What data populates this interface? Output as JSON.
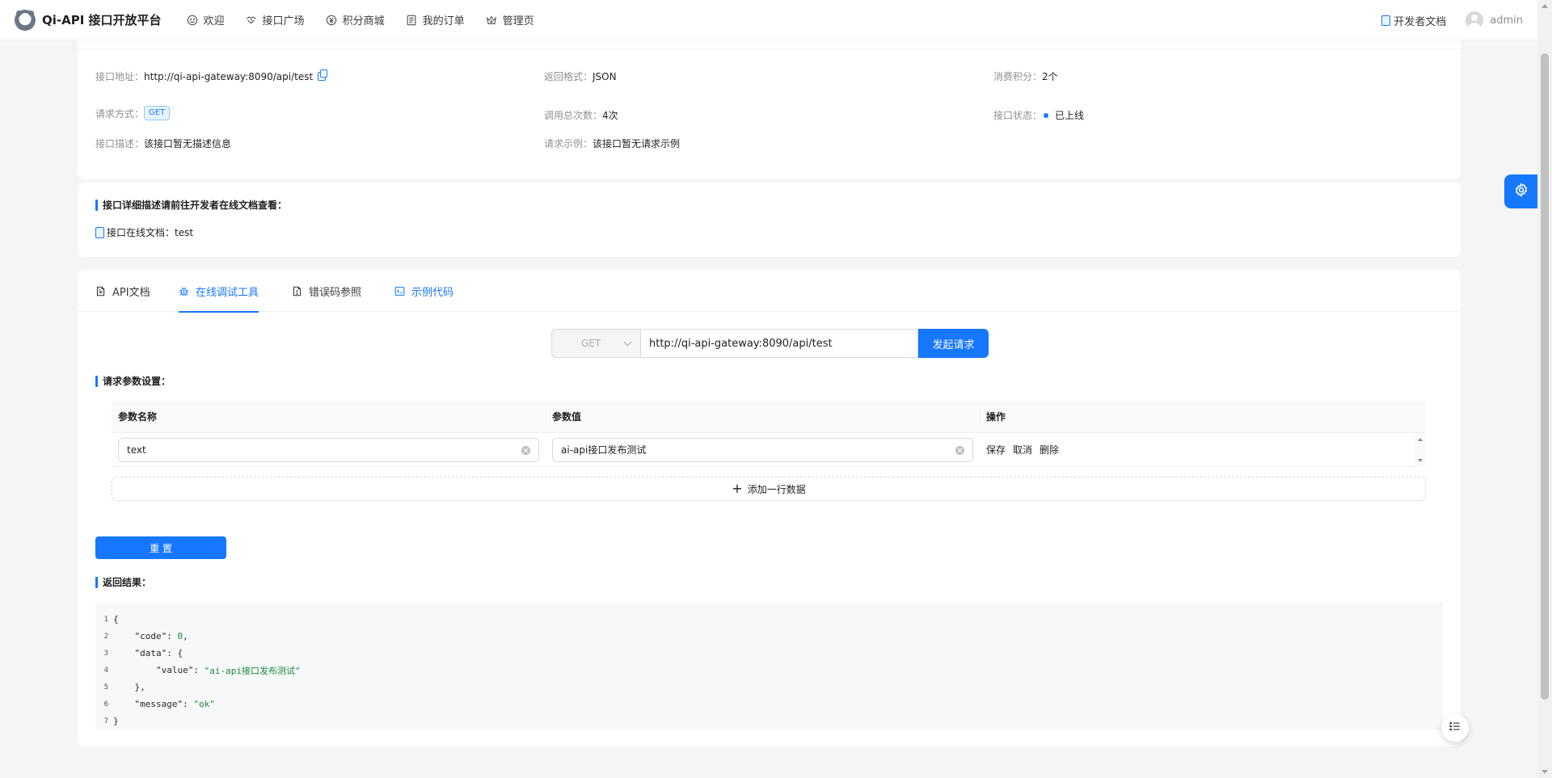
{
  "brand": {
    "title": "Qi-API 接口开放平台"
  },
  "nav": {
    "items": [
      {
        "label": "欢迎",
        "icon": "smile-icon"
      },
      {
        "label": "接口广场",
        "icon": "handshake-icon"
      },
      {
        "label": "积分商城",
        "icon": "money-circle-icon"
      },
      {
        "label": "我的订单",
        "icon": "order-icon"
      },
      {
        "label": "管理页",
        "icon": "crown-icon"
      }
    ]
  },
  "header_right": {
    "doc_label": "开发者文档",
    "username": "admin"
  },
  "info": {
    "url_label": "接口地址：",
    "url_value": "http://qi-api-gateway:8090/api/test",
    "format_label": "返回格式：",
    "format_value": "JSON",
    "points_label": "消费积分：",
    "points_value": "2个",
    "method_label": "请求方式：",
    "method_value": "GET",
    "calls_label": "调用总次数：",
    "calls_value": "4次",
    "status_label": "接口状态：",
    "status_value": "已上线",
    "desc_label": "接口描述：",
    "desc_value": "该接口暂无描述信息",
    "example_label": "请求示例：",
    "example_value": "该接口暂无请求示例"
  },
  "doc_card": {
    "title": "接口详细描述请前往开发者在线文档查看：",
    "line_label": "接口在线文档：",
    "line_value": "test"
  },
  "tabs": [
    {
      "label": "API文档",
      "icon": "file-text-icon"
    },
    {
      "label": "在线调试工具",
      "icon": "bug-icon"
    },
    {
      "label": "错误码参照",
      "icon": "file-exclamation-icon"
    },
    {
      "label": "示例代码",
      "icon": "code-icon"
    }
  ],
  "request": {
    "method": "GET",
    "url": "http://qi-api-gateway:8090/api/test",
    "send_label": "发起请求"
  },
  "params": {
    "title": "请求参数设置：",
    "headers": [
      "参数名称",
      "参数值",
      "操作"
    ],
    "rows": [
      {
        "name": "text",
        "value": "ai-api接口发布测试",
        "actions": [
          "保存",
          "取消",
          "删除"
        ]
      }
    ],
    "add_label": "添加一行数据"
  },
  "reset_label": "重 置",
  "result": {
    "title": "返回结果：",
    "lines": [
      {
        "n": "1",
        "pre": "{",
        "str": "",
        "post": ""
      },
      {
        "n": "2",
        "pre": "    \"code\": ",
        "str": "0",
        "post": ","
      },
      {
        "n": "3",
        "pre": "    \"data\": {",
        "str": "",
        "post": ""
      },
      {
        "n": "4",
        "pre": "        \"value\": ",
        "str": "\"ai-api接口发布测试\"",
        "post": ""
      },
      {
        "n": "5",
        "pre": "    },",
        "str": "",
        "post": ""
      },
      {
        "n": "6",
        "pre": "    \"message\": ",
        "str": "\"ok\"",
        "post": ""
      },
      {
        "n": "7",
        "pre": "}",
        "str": "",
        "post": ""
      }
    ]
  },
  "colors": {
    "primary": "#1677ff",
    "background": "#f5f5f5",
    "code_bg": "#f6f8fa",
    "json_string": "#22863a"
  }
}
